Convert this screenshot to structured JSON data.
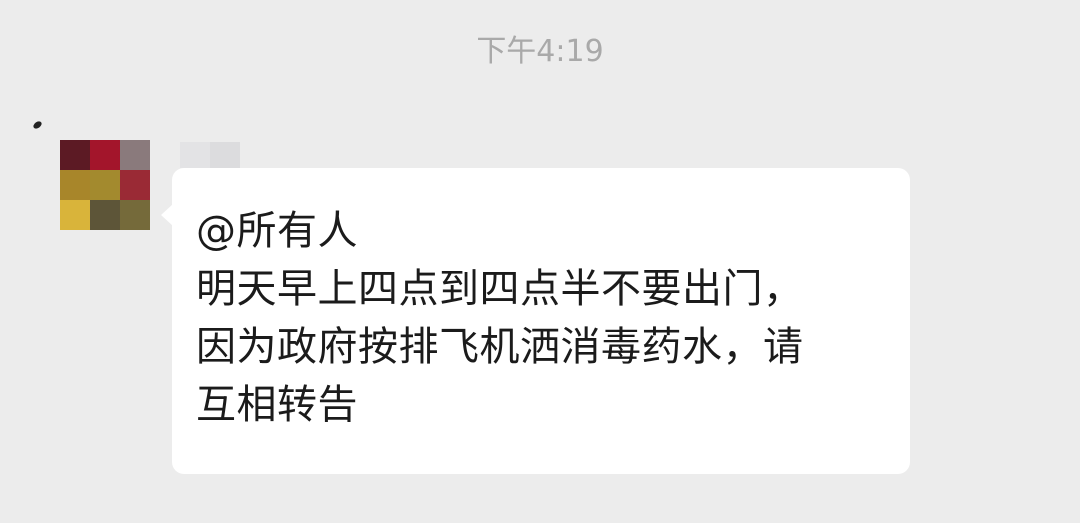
{
  "chat": {
    "timestamp": "下午4:19",
    "message": {
      "lines": [
        "@所有人",
        "明天早上四点到四点半不要出门，",
        "因为政府按排飞机洒消毒药水，请",
        "互相转告"
      ]
    },
    "sender": {
      "avatar_colors": [
        "#5c1a24",
        "#a3152b",
        "#8a7a7c",
        "#a8862a",
        "#a38a2e",
        "#9a2a35",
        "#d9b43a",
        "#5d5538",
        "#756a3a"
      ]
    }
  }
}
